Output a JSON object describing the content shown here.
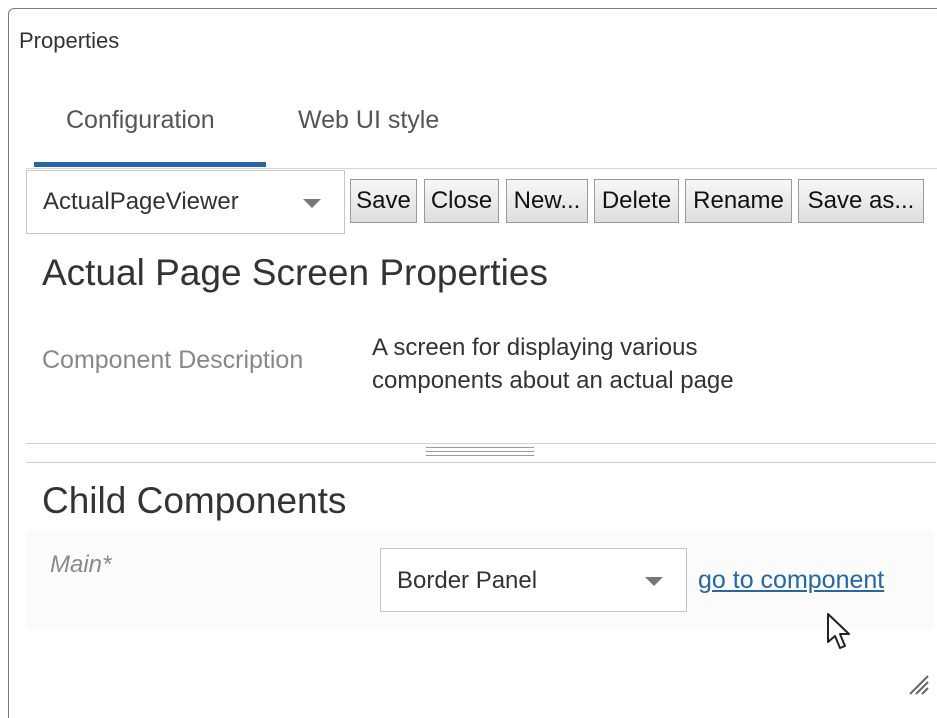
{
  "window": {
    "title": "Properties"
  },
  "tabs": [
    {
      "label": "Configuration",
      "active": true
    },
    {
      "label": "Web UI style",
      "active": false
    }
  ],
  "toolbar": {
    "config_select": {
      "value": "ActualPageViewer"
    },
    "save_label": "Save",
    "close_label": "Close",
    "new_label": "New...",
    "delete_label": "Delete",
    "rename_label": "Rename",
    "save_as_label": "Save as..."
  },
  "properties": {
    "title": "Actual Page Screen Properties",
    "description_label": "Component Description",
    "description_line1": "A screen for displaying various",
    "description_line2": "components about an actual page"
  },
  "child_components": {
    "title": "Child Components",
    "main_label": "Main*",
    "main_value": "Border Panel",
    "link_label": "go to component"
  },
  "colors": {
    "accent": "#2566a4",
    "link": "#2566a4"
  },
  "icons": [
    "chevron-down-icon",
    "mouse-pointer-icon",
    "resize-grip-icon",
    "splitter-grip-icon"
  ]
}
